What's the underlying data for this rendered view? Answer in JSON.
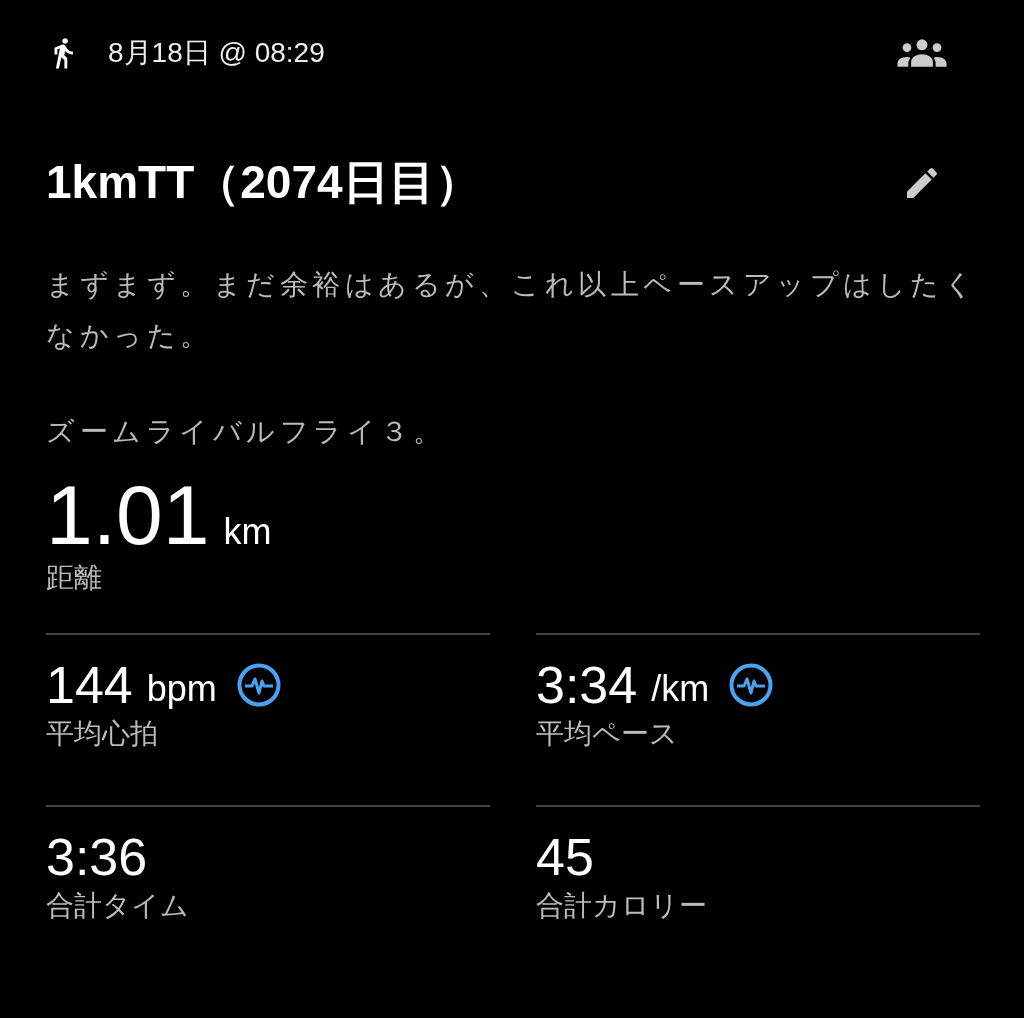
{
  "header": {
    "date": "8月18日 @ 08:29"
  },
  "title": "1kmTT（2074日目）",
  "notes": [
    "まずまず。まだ余裕はあるが、これ以上ペースアップはしたくなかった。",
    "ズームライバルフライ３。"
  ],
  "distance": {
    "value": "1.01",
    "unit": "km",
    "label": "距離"
  },
  "stats": [
    {
      "value": "144",
      "unit": "bpm",
      "label": "平均心拍",
      "badge": true
    },
    {
      "value": "3:34",
      "unit": "/km",
      "label": "平均ペース",
      "badge": true
    },
    {
      "value": "3:36",
      "label": "合計タイム",
      "badge": false
    },
    {
      "value": "45",
      "label": "合計カロリー",
      "badge": false
    }
  ]
}
